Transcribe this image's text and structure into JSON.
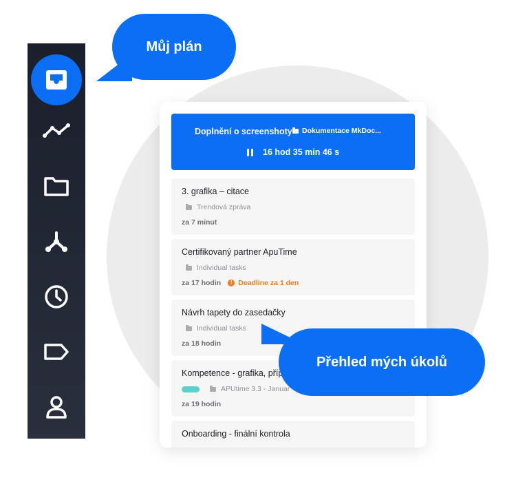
{
  "bubbles": {
    "plan": "Můj plán",
    "overview": "Přehled mých úkolů"
  },
  "sidebar": {
    "items": [
      {
        "icon": "inbox-icon",
        "active": true
      },
      {
        "icon": "chart-line-icon",
        "active": false
      },
      {
        "icon": "folder-icon",
        "active": false
      },
      {
        "icon": "network-icon",
        "active": false
      },
      {
        "icon": "clock-icon",
        "active": false
      },
      {
        "icon": "tag-icon",
        "active": false
      },
      {
        "icon": "user-icon",
        "active": false
      }
    ]
  },
  "timer": {
    "title": "Doplnění o screenshoty",
    "folder": "Dokumentace MkDoc...",
    "elapsed": "16 hod 35 min 46 s"
  },
  "tasks": [
    {
      "title": "3. grafika – citace",
      "project": "Trendová zpráva",
      "due": "za 7 minut",
      "deadline": ""
    },
    {
      "title": "Certifikovaný partner ApuTime",
      "project": "Individual tasks",
      "due": "za 17 hodin",
      "deadline": "Deadline za 1 den"
    },
    {
      "title": "Návrh tapety do zasedačky",
      "project": "Individual tasks",
      "due": "za 18 hodin",
      "deadline": ""
    },
    {
      "title": "Kompetence - grafika, příp",
      "project": "APUtime 3.3 - Januar",
      "due": "za 19 hodin",
      "deadline": ""
    },
    {
      "title": "Onboarding - finální kontrola",
      "project": "",
      "due": "",
      "deadline": ""
    }
  ],
  "colors": {
    "accent": "#0a6ff5",
    "sidebar": "#1b1f2c",
    "warning": "#f07b1a",
    "tag": "#5ccfcf"
  }
}
